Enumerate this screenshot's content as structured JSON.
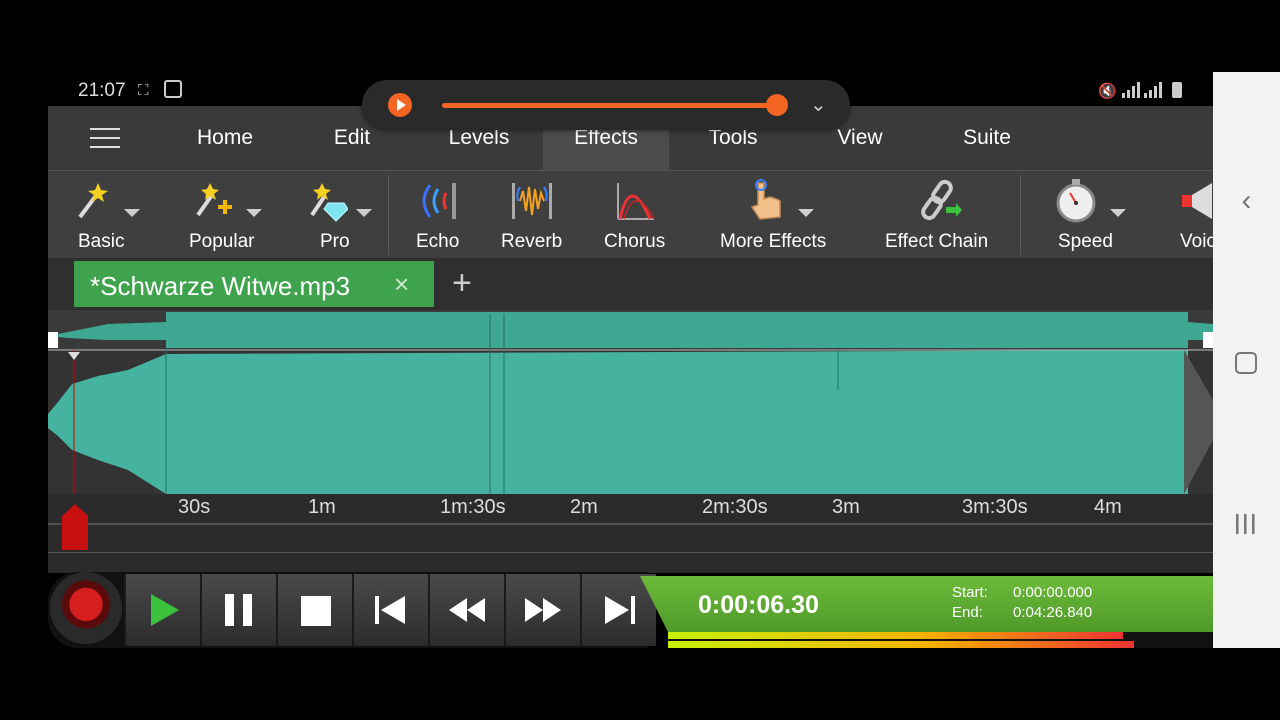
{
  "status_bar": {
    "time": "21:07"
  },
  "menu": {
    "items": [
      {
        "label": "Home",
        "active": false
      },
      {
        "label": "Edit",
        "active": false
      },
      {
        "label": "Levels",
        "active": false
      },
      {
        "label": "Effects",
        "active": true
      },
      {
        "label": "Tools",
        "active": false
      },
      {
        "label": "View",
        "active": false
      },
      {
        "label": "Suite",
        "active": false
      }
    ]
  },
  "toolbar": {
    "items": [
      {
        "label": "Basic",
        "icon": "magic-wand-icon",
        "dropdown": true
      },
      {
        "label": "Popular",
        "icon": "magic-wand-plus-icon",
        "dropdown": true
      },
      {
        "label": "Pro",
        "icon": "magic-wand-diamond-icon",
        "dropdown": true
      },
      {
        "label": "Echo",
        "icon": "echo-icon",
        "dropdown": false
      },
      {
        "label": "Reverb",
        "icon": "reverb-icon",
        "dropdown": false
      },
      {
        "label": "Chorus",
        "icon": "chorus-icon",
        "dropdown": false
      },
      {
        "label": "More Effects",
        "icon": "hand-pointer-icon",
        "dropdown": true
      },
      {
        "label": "Effect Chain",
        "icon": "chain-link-icon",
        "dropdown": false
      },
      {
        "label": "Speed",
        "icon": "stopwatch-icon",
        "dropdown": true
      },
      {
        "label": "Voic",
        "icon": "megaphone-icon",
        "dropdown": false
      }
    ]
  },
  "tabs": {
    "file": "*Schwarze Witwe.mp3",
    "close": "×",
    "add": "+"
  },
  "timeline": {
    "labels": [
      "30s",
      "1m",
      "1m:30s",
      "2m",
      "2m:30s",
      "3m",
      "3m:30s",
      "4m"
    ]
  },
  "transport": {
    "current_time": "0:00:06.30",
    "start_label": "Start:",
    "start_value": "0:00:00.000",
    "end_label": "End:",
    "end_value": "0:04:26.840"
  },
  "colors": {
    "accent_orange": "#f26522",
    "file_tab_green": "#3fa34d",
    "waveform": "#3fae9a",
    "record_red": "#d62020"
  }
}
